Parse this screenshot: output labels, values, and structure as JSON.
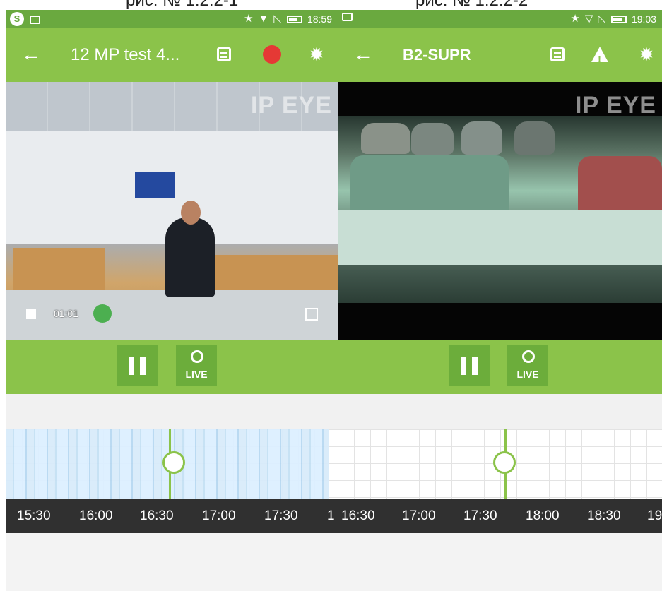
{
  "captions": {
    "left": "рис. № 1.2.2-1",
    "right": "рис. № 1.2.2-2"
  },
  "panels": [
    {
      "status": {
        "time": "18:59",
        "left_icons": [
          "skype-icon",
          "image-icon"
        ],
        "right_icons": [
          "star-icon",
          "wifi-icon",
          "signal-icon",
          "battery-icon"
        ]
      },
      "appbar": {
        "back_label": "←",
        "title": "12 MP test 4...",
        "actions": [
          "calendar-icon",
          "alarm-bell-icon",
          "settings-icon"
        ]
      },
      "video": {
        "elapsed": "01:01",
        "watermark": "IP EYE"
      },
      "controls": {
        "pause_label": "pause",
        "live_label": "LIVE"
      },
      "timeline": {
        "ticks": [
          "15:30",
          "16:00",
          "16:30",
          "17:00",
          "17:30",
          "1"
        ]
      }
    },
    {
      "status": {
        "time": "19:03",
        "left_icons": [
          "image-icon"
        ],
        "right_icons": [
          "star-icon",
          "wifi-icon",
          "signal-icon",
          "battery-icon"
        ]
      },
      "appbar": {
        "back_label": "←",
        "title": "B2-SUPR",
        "actions": [
          "calendar-icon",
          "warning-icon",
          "settings-icon"
        ]
      },
      "video": {
        "watermark": "IP EYE"
      },
      "controls": {
        "pause_label": "pause",
        "live_label": "LIVE"
      },
      "timeline": {
        "ticks": [
          "16:30",
          "17:00",
          "17:30",
          "18:00",
          "18:30",
          "19"
        ]
      }
    }
  ],
  "colors": {
    "status_green": "#6aa93f",
    "toolbar_green": "#8bc34a",
    "button_green": "#6cad3b",
    "timeline_blue": "#c4e0f4",
    "timebar_dark": "#303030"
  }
}
